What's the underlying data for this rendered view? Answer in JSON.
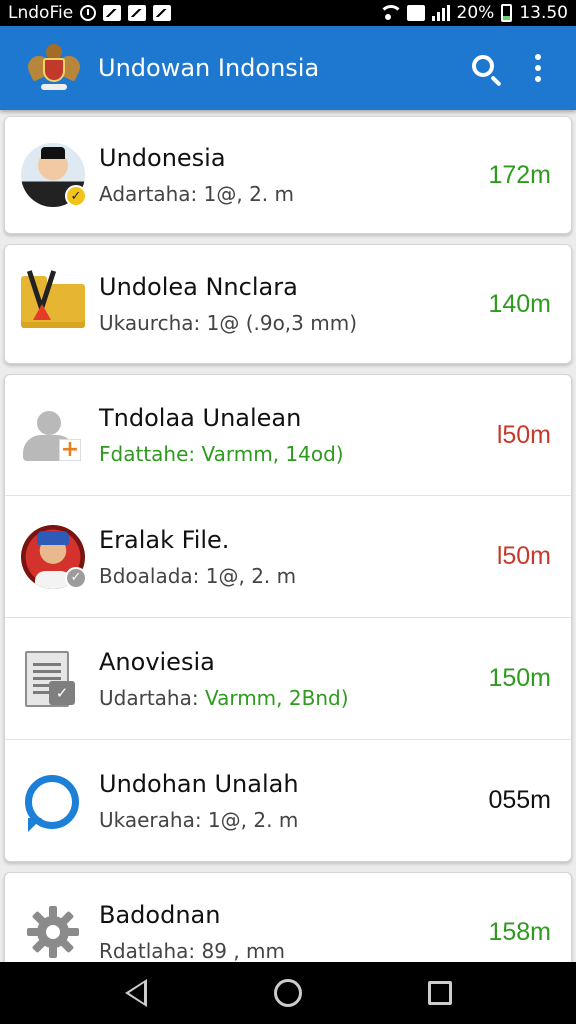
{
  "status_bar": {
    "carrier": "LndoFie",
    "battery": "20%",
    "time": "13.50",
    "icons": [
      "clock-icon",
      "image-icon",
      "chart-icon",
      "gallery-icon",
      "wifi-icon",
      "sim-icon",
      "signal-icon",
      "battery-icon"
    ]
  },
  "app_bar": {
    "title": "Undowan Indonsia",
    "color": "#1f78cf",
    "icons": [
      "emblem-logo",
      "search-icon",
      "overflow-menu-icon"
    ]
  },
  "items": [
    {
      "name": "Undonesia",
      "sub": "Adartaha: 1@, 2. m",
      "sub_highlight": "",
      "value": "172m",
      "value_color": "#2e9b1e",
      "icon": "profile-avatar"
    },
    {
      "name": "Undolea Nnclara",
      "sub": "Ukaurcha: 1@ (.9o,3 mm)",
      "sub_highlight": "",
      "value": "140m",
      "value_color": "#2e9b1e",
      "icon": "folder-icon"
    },
    {
      "name": "Tndolaa Unalean",
      "sub": "Fdattahe: Varmm, 14od)",
      "sub_highlight": "",
      "value": "l50m",
      "value_color": "#c7392b",
      "icon": "add-person-icon"
    },
    {
      "name": "Eralak File.",
      "sub": "Bdoalada: 1@, 2. m",
      "sub_highlight": "",
      "value": "l50m",
      "value_color": "#c7392b",
      "icon": "profile-avatar"
    },
    {
      "name": "Anoviesia",
      "sub": "Udartaha: ",
      "sub_highlight": "Varmm, 2Bnd)",
      "value": "150m",
      "value_color": "#2e9b1e",
      "icon": "document-icon"
    },
    {
      "name": "Undohan Unalah",
      "sub": "Ukaeraha: 1@, 2. m",
      "sub_highlight": "",
      "value": "055m",
      "value_color": "#111111",
      "icon": "chat-icon"
    },
    {
      "name": "Badodnan",
      "sub": "Rdatlaha: 89 , mm",
      "sub_highlight": "",
      "value": "158m",
      "value_color": "#2e9b1e",
      "icon": "settings-icon"
    }
  ],
  "nav_bar": {
    "icons": [
      "back-icon",
      "home-icon",
      "recents-icon"
    ]
  }
}
